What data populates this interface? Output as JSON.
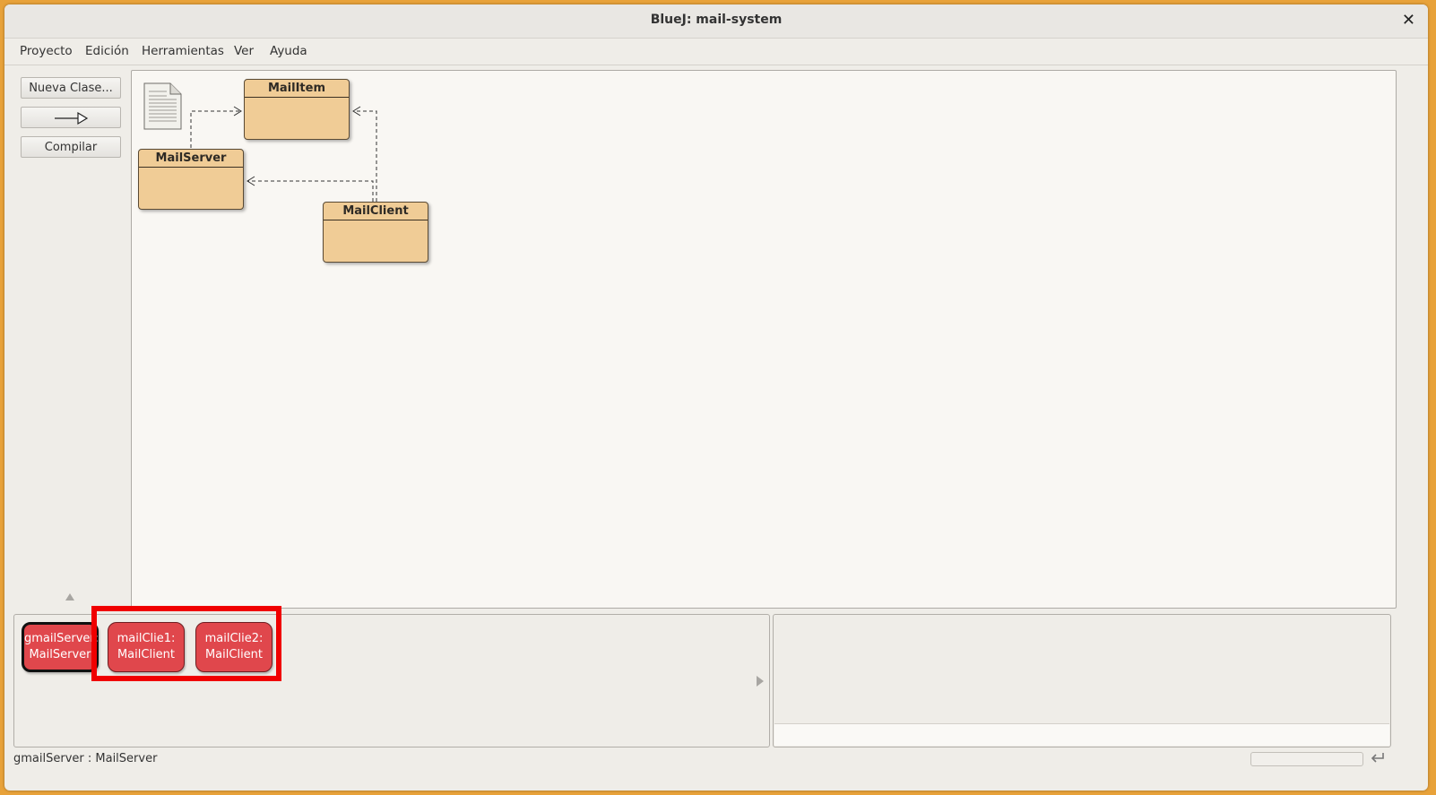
{
  "window": {
    "title": "BlueJ: mail-system",
    "close_glyph": "✕"
  },
  "menu": [
    "Proyecto",
    "Edición",
    "Herramientas",
    "Ver",
    "Ayuda"
  ],
  "sidebar": {
    "new_class": "Nueva Clase...",
    "arrow_icon": "inheritance-arrow-icon",
    "compile": "Compilar"
  },
  "classes": [
    {
      "name": "MailItem"
    },
    {
      "name": "MailServer"
    },
    {
      "name": "MailClient"
    }
  ],
  "objects": [
    {
      "line1": "gmailServer:",
      "line2": "MailServer",
      "selected": true
    },
    {
      "line1": "mailClie1:",
      "line2": "MailClient",
      "selected": false
    },
    {
      "line1": "mailClie2:",
      "line2": "MailClient",
      "selected": false
    }
  ],
  "status": {
    "text": "gmailServer : MailServer"
  },
  "colors": {
    "class_fill": "#f0cc96",
    "object_fill": "#e0474c",
    "highlight_border": "#f00000",
    "desktop": "#e8a23a"
  }
}
